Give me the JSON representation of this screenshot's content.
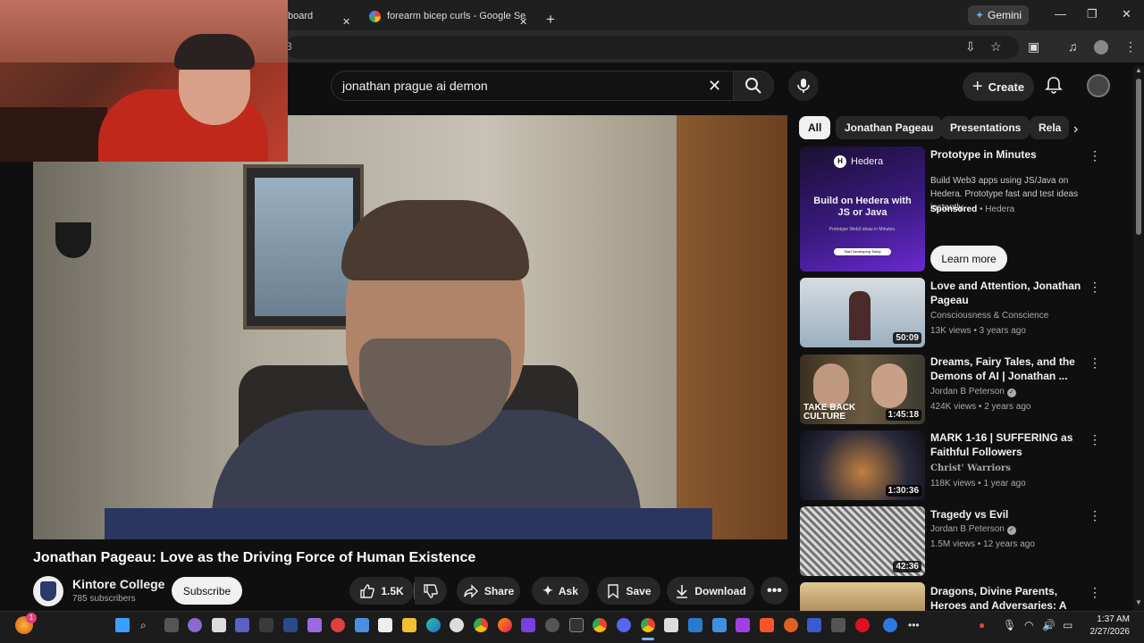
{
  "browser": {
    "tabs": [
      {
        "label": "board"
      },
      {
        "label": "forearm bicep curls - Google Se"
      }
    ],
    "gemini_label": "Gemini",
    "omnibox_text": "3"
  },
  "header": {
    "search_query": "jonathan prague ai demon",
    "create_label": "Create"
  },
  "video": {
    "title": "Jonathan Pageau: Love as the Driving Force of Human Existence",
    "channel": "Kintore College",
    "subscribers": "785 subscribers",
    "subscribe_label": "Subscribe",
    "likes": "1.5K",
    "share_label": "Share",
    "ask_label": "Ask",
    "save_label": "Save",
    "download_label": "Download"
  },
  "chips": [
    "All",
    "Jonathan Pageau",
    "Presentations",
    "Rela"
  ],
  "sponsored": {
    "title": "Prototype in Minutes",
    "description": "Build Web3 apps using JS/Java on Hedera. Prototype fast and test ideas instantly.",
    "sponsored_label": "Sponsored",
    "advertiser": "Hedera",
    "learn_more": "Learn more",
    "thumb_logo": "Hedera",
    "thumb_headline": "Build on Hedera with JS or Java",
    "thumb_sub": "Prototype Web3 ideas in Minutes.",
    "thumb_cta": "Start Developing Today"
  },
  "related": [
    {
      "title": "Love and Attention, Jonathan Pageau",
      "channel": "Consciousness & Conscience",
      "meta": "13K views • 3 years ago",
      "duration": "50:09",
      "verified": false
    },
    {
      "title": "Dreams, Fairy Tales, and the Demons of AI | Jonathan ...",
      "channel": "Jordan B Peterson",
      "meta": "424K views • 2 years ago",
      "duration": "1:45:18",
      "verified": true,
      "thumb_text": "TAKE BACK CULTURE"
    },
    {
      "title": "MARK 1-16 | SUFFERING as Faithful Followers",
      "channel": "Christ' Warriors",
      "meta": "118K views • 1 year ago",
      "duration": "1:30:36",
      "verified": false
    },
    {
      "title": "Tragedy vs Evil",
      "channel": "Jordan B Peterson",
      "meta": "1.5M views • 12 years ago",
      "duration": "42:36",
      "verified": true
    },
    {
      "title": "Dragons, Divine Parents, Heroes and Adversaries: A complete",
      "channel": "",
      "meta": "",
      "duration": "",
      "verified": false
    }
  ],
  "taskbar": {
    "notification_count": "1",
    "time": "1:37 AM",
    "date": "2/27/2026"
  },
  "colors": {
    "background": "#0f0f0f",
    "chip_bg": "#272727",
    "accent_red": "#ff0000"
  }
}
